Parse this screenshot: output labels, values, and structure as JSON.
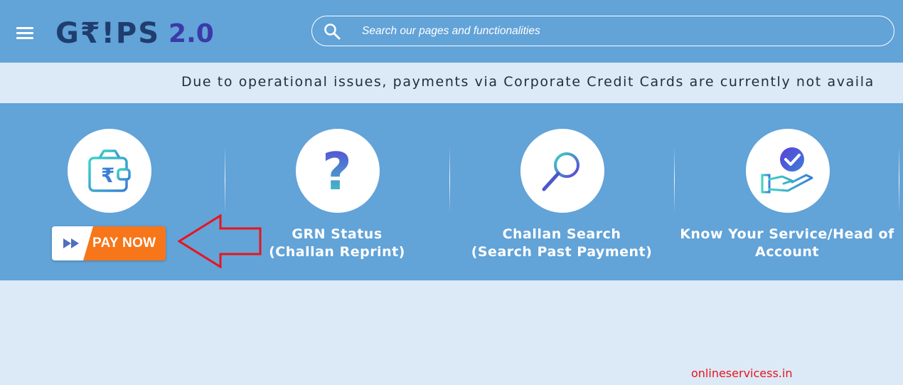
{
  "header": {
    "logo_text": "G₹!PS",
    "logo_version": "2.0",
    "search": {
      "placeholder": "Search our pages and functionalities"
    }
  },
  "notice": {
    "text": "Due to operational issues, payments via Corporate Credit Cards are currently not availa"
  },
  "services": [
    {
      "name": "pay-now",
      "button_label": "PAY NOW",
      "icon": "wallet-rupee-icon"
    },
    {
      "name": "grn-status",
      "line1": "GRN Status",
      "line2": "(Challan Reprint)",
      "icon": "question-mark-icon"
    },
    {
      "name": "challan-search",
      "line1": "Challan Search",
      "line2": "(Search Past Payment)",
      "icon": "magnifier-icon"
    },
    {
      "name": "know-service",
      "line1": "Know Your Service/Head of",
      "line2": "Account",
      "icon": "hand-check-icon"
    }
  ],
  "watermark": "onlineservicess.in",
  "colors": {
    "header_bg": "#62a3d8",
    "notice_bg": "#dce9f7",
    "pay_orange": "#f7761a",
    "annotation_arrow": "#e8141b"
  }
}
